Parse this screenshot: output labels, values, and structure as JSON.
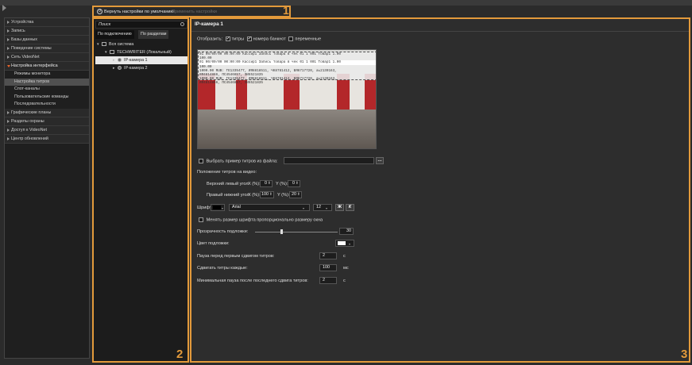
{
  "toolbar": {
    "number": "1",
    "reset_label": "Вернуть настройки по умолчанию",
    "apply_label": "Применить настройки"
  },
  "nav": {
    "items": [
      {
        "label": "Устройства"
      },
      {
        "label": "Запись"
      },
      {
        "label": "Базы данных"
      },
      {
        "label": "Поведение системы"
      },
      {
        "label": "Сеть VideoNet"
      },
      {
        "label": "Настройка интерфейса"
      },
      {
        "label": "Графические планы"
      },
      {
        "label": "Разделы охраны"
      },
      {
        "label": "Доступ к VideoNet"
      },
      {
        "label": "Центр обновлений"
      }
    ],
    "sub_items": [
      {
        "label": "Режимы монитора"
      },
      {
        "label": "Настройка титров"
      },
      {
        "label": "Спот-каналы"
      },
      {
        "label": "Пользовательские команды"
      },
      {
        "label": "Последовательности"
      }
    ]
  },
  "panel2": {
    "number": "2",
    "search_placeholder": "Поиск",
    "tab_connection": "По подключению",
    "tab_sections": "По разделам",
    "tree": [
      {
        "label": "Вся система"
      },
      {
        "label": "TECHWRITER (Локальный)"
      },
      {
        "label": "IP-камера 1"
      },
      {
        "label": "IP-камера 2"
      }
    ]
  },
  "panel3": {
    "number": "3",
    "title": "IP-камера 1",
    "show_label": "Отобразить:",
    "chk_titles": "титры",
    "chk_banknotes": "номера банкнот",
    "chk_variables": "переменные",
    "overlay_lines": [
      "01  00/00/00  00:00:00  Кассир1  Запись товара в чек  01  1  001  Товар1  1.00",
      "100.00",
      "01  00/00/00  00:00:00  Кассир1  Запись товара в чек  01  1  001  Товар1  1.00",
      "100.00",
      "1000.00 RUB: ГЕ1335477, ИЯ8818511, ЧК8781412, БЯ6717720, аь2130163,",
      "ИЯ4814866, ПС4546857, ЗИ6521835",
      "1000.00 RUB: ГЕ1335477, ИЯ8818511, ЧК8781412, БЯ6717720, аь2130163,",
      "ИЯ4814866, ПС4546857, ЗИ6521835"
    ],
    "choose_file_label": "Выбрать пример титров из файла:",
    "position_label": "Положение титров на видео:",
    "top_left_label": "Верхний левый угол",
    "bottom_right_label": "Правый нижний угол",
    "x_label": "X (%):",
    "y_label": "Y (%):",
    "tl_x": "0",
    "tl_y": "0",
    "br_x": "100",
    "br_y": "20",
    "font_label": "Шрифт:",
    "font_name": "Arial",
    "font_size": "12",
    "bold_label": "Ж",
    "italic_label": "К",
    "resize_label": "Менять размер шрифта пропорционально размеру окна",
    "transparency_label": "Прозрачность подложки:",
    "transparency_value": "30",
    "bg_color_label": "Цвет подложки:",
    "pause_first_label": "Пауза перед первым сдвигом титров:",
    "pause_first_value": "2",
    "pause_first_unit": "с",
    "shift_every_label": "Сдвигать титры каждые:",
    "shift_every_value": "100",
    "shift_every_unit": "мс",
    "min_pause_label": "Минимальная пауза после последнего сдвига титров:",
    "min_pause_value": "2",
    "min_pause_unit": "с",
    "colors": {
      "accent": "#e39a3b",
      "font_color": "#000000",
      "bg_color": "#ffffff"
    }
  }
}
